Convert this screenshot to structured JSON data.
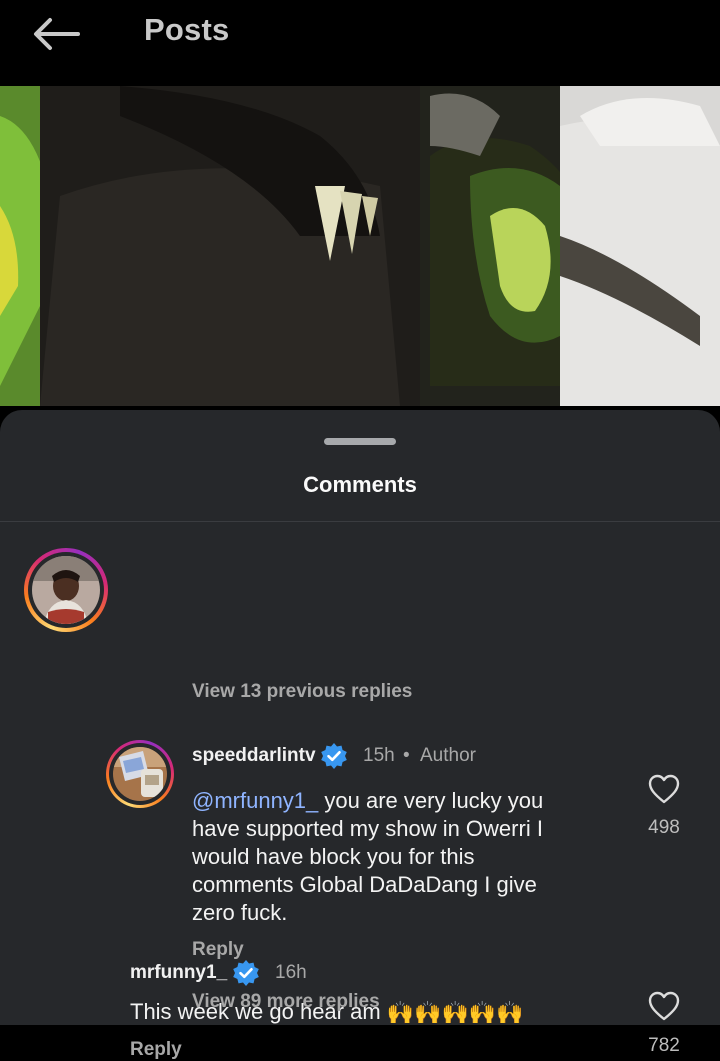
{
  "header": {
    "title": "Posts",
    "back_icon": "arrow-left-icon"
  },
  "sheet": {
    "title": "Comments"
  },
  "comments": [
    {
      "username": "mrfunny1_",
      "verified": true,
      "time": "16h",
      "text": "This week we go hear am",
      "emoji": "🙌🙌🙌🙌🙌",
      "reply_label": "Reply",
      "likes": "782",
      "view_replies": "View 13 previous replies"
    },
    {
      "username": "speeddarlintv",
      "verified": true,
      "time": "15h",
      "separator": "•",
      "author_label": "Author",
      "mention": "@mrfunny1_",
      "text_lines": [
        " you are very lucky you",
        "have supported my show in Owerri I",
        "would have block you for this",
        "comments Global DaDaDang I give",
        "zero fuck."
      ],
      "reply_label": "Reply",
      "likes": "498",
      "view_replies": "View 89 more replies"
    }
  ],
  "colors": {
    "sheet_bg": "#26282b",
    "verified": "#3897f0",
    "mention": "#8fb4ff"
  }
}
